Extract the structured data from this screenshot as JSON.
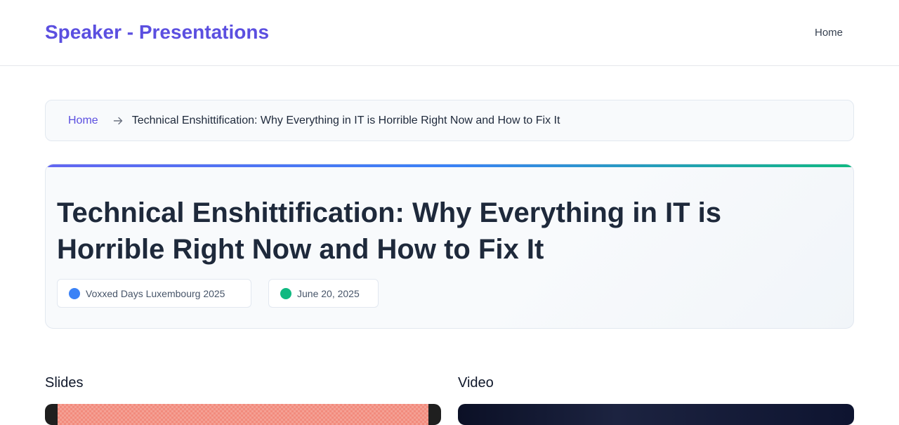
{
  "site": {
    "title": "Speaker - Presentations",
    "nav": {
      "home_label": "Home"
    }
  },
  "breadcrumb": {
    "home_label": "Home",
    "separator_icon": "arrow-right-icon",
    "current": "Technical Enshittification: Why Everything in IT is Horrible Right Now and How to Fix It"
  },
  "presentation": {
    "title": "Technical Enshittification: Why Everything in IT is Horrible Right Now and How to Fix It",
    "event": "Voxxed Days Luxembourg 2025",
    "date": "June 20, 2025"
  },
  "sections": {
    "slides_heading": "Slides",
    "video_heading": "Video"
  },
  "colors": {
    "brand": "#5b4fe0",
    "event_dot": "#3b82f6",
    "date_dot": "#10b981",
    "accent_gradient": [
      "#6366f1",
      "#3b82f6",
      "#10b981"
    ]
  }
}
